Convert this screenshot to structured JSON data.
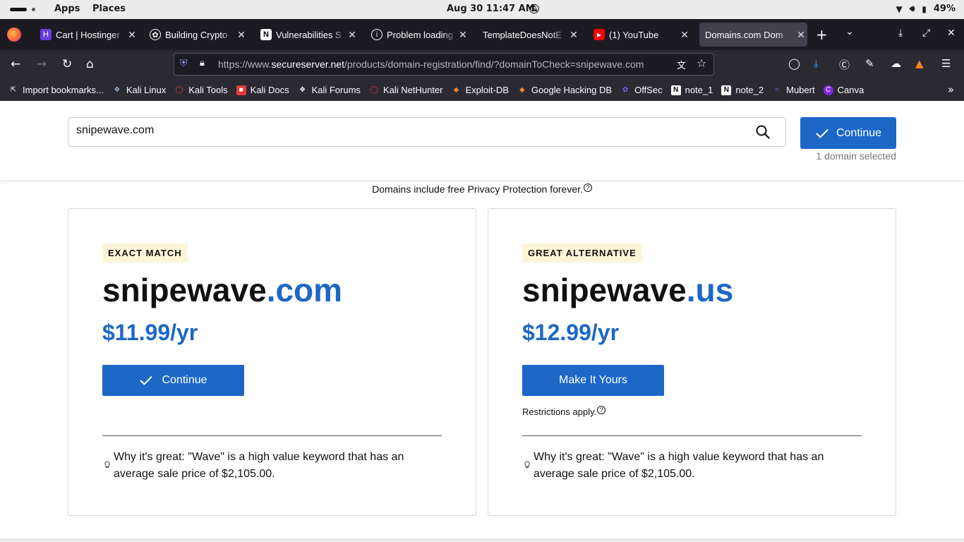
{
  "topbar": {
    "apps": "Apps",
    "places": "Places",
    "clock": "Aug 30  11:47 AM",
    "battery": "49%"
  },
  "tabs": [
    {
      "label": "Cart | Hostinger",
      "icon": "hostinger-icon",
      "color": "#673de6"
    },
    {
      "label": "Building Crypto",
      "icon": "openai-icon",
      "color": "#ffffff"
    },
    {
      "label": "Vulnerabilities S",
      "icon": "notion-icon",
      "color": "#ffffff"
    },
    {
      "label": "Problem loading",
      "icon": "info-icon",
      "color": "#ffffff"
    },
    {
      "label": "TemplateDoesNotE",
      "icon": "",
      "color": ""
    },
    {
      "label": "(1) YouTube",
      "icon": "youtube-icon",
      "color": "#ff0000"
    },
    {
      "label": "Domains.com Dom",
      "icon": "",
      "color": ""
    }
  ],
  "urlbar": {
    "prefix": "https://www.",
    "host": "secureserver.net",
    "path": "/products/domain-registration/find/?domainToCheck=snipewave.com"
  },
  "bookmarks": [
    {
      "label": "Import bookmarks...",
      "icon": "import-icon",
      "color": "#fbfbfe"
    },
    {
      "label": "Kali Linux",
      "icon": "kali-icon",
      "color": "#2f7bd6"
    },
    {
      "label": "Kali Tools",
      "icon": "kali-tools-icon",
      "color": "#e4393a"
    },
    {
      "label": "Kali Docs",
      "icon": "kali-docs-icon",
      "color": "#e4393a"
    },
    {
      "label": "Kali Forums",
      "icon": "kali-forums-icon",
      "color": "#ffffff"
    },
    {
      "label": "Kali NetHunter",
      "icon": "nethunter-icon",
      "color": "#e4393a"
    },
    {
      "label": "Exploit-DB",
      "icon": "exploitdb-icon",
      "color": "#f0812b"
    },
    {
      "label": "Google Hacking DB",
      "icon": "ghdb-icon",
      "color": "#f0812b"
    },
    {
      "label": "OffSec",
      "icon": "offsec-icon",
      "color": "#8a5cf6"
    },
    {
      "label": "note_1",
      "icon": "notion-icon",
      "color": "#ffffff"
    },
    {
      "label": "note_2",
      "icon": "notion-icon",
      "color": "#ffffff"
    },
    {
      "label": "Mubert",
      "icon": "mubert-icon",
      "color": "#8a5cf6"
    },
    {
      "label": "Canva",
      "icon": "canva-icon",
      "color": "#7d2ae8"
    }
  ],
  "search": {
    "value": "snipewave.com",
    "continue_label": "Continue",
    "selected_count": "1 domain selected"
  },
  "privacy_note": "Domains include free Privacy Protection forever.",
  "cards": [
    {
      "badge": "EXACT MATCH",
      "name": "snipewave",
      "tld": ".com",
      "price": "$11.99/yr",
      "action_label": "Continue",
      "restrictions": "",
      "why": "Why it's great: \"Wave\" is a high value keyword that has an average sale price of $2,105.00."
    },
    {
      "badge": "GREAT ALTERNATIVE",
      "name": "snipewave",
      "tld": ".us",
      "price": "$12.99/yr",
      "action_label": "Make It Yours",
      "restrictions": "Restrictions apply.",
      "why": "Why it's great: \"Wave\" is a high value keyword that has an average sale price of $2,105.00."
    }
  ],
  "colors": {
    "accent": "#1d67c7",
    "badge_bg": "#fdf5d7"
  }
}
